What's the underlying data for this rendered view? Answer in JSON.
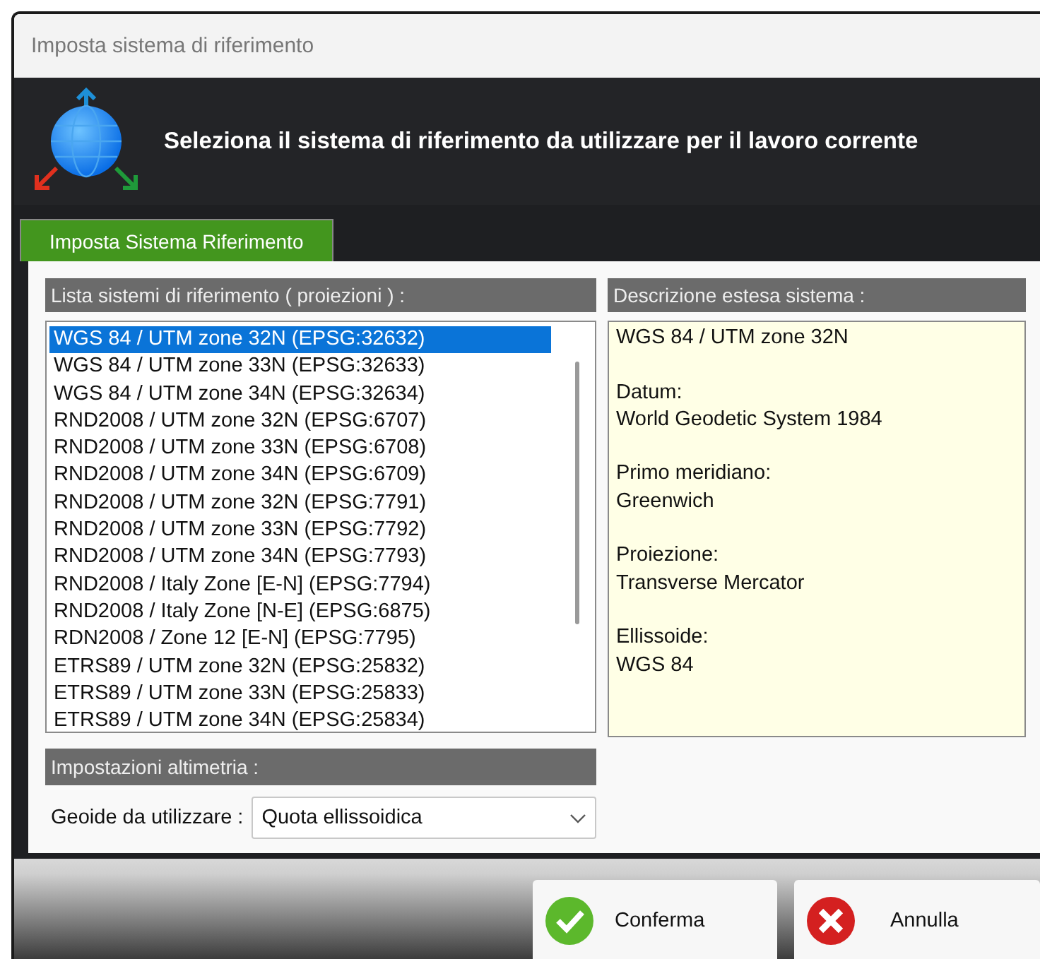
{
  "window": {
    "title": "Imposta sistema di riferimento"
  },
  "header": {
    "message": "Seleziona il sistema di riferimento da utilizzare per il lavoro corrente"
  },
  "tabs": [
    {
      "label": "Imposta Sistema Riferimento",
      "selected": true
    }
  ],
  "projection_list": {
    "heading": "Lista sistemi di riferimento ( proiezioni ) :",
    "items": [
      {
        "label": "WGS 84 / UTM zone 32N (EPSG:32632)",
        "selected": true
      },
      {
        "label": "WGS 84 / UTM zone 33N (EPSG:32633)",
        "selected": false
      },
      {
        "label": "WGS 84 / UTM zone 34N (EPSG:32634)",
        "selected": false
      },
      {
        "label": "RND2008 / UTM zone 32N (EPSG:6707)",
        "selected": false
      },
      {
        "label": "RND2008 / UTM zone 33N (EPSG:6708)",
        "selected": false
      },
      {
        "label": "RND2008 / UTM zone 34N (EPSG:6709)",
        "selected": false
      },
      {
        "label": "RND2008 / UTM zone 32N (EPSG:7791)",
        "selected": false
      },
      {
        "label": "RND2008 / UTM zone 33N (EPSG:7792)",
        "selected": false
      },
      {
        "label": "RND2008 / UTM zone 34N (EPSG:7793)",
        "selected": false
      },
      {
        "label": "RND2008 / Italy Zone [E-N] (EPSG:7794)",
        "selected": false
      },
      {
        "label": "RND2008 / Italy Zone [N-E] (EPSG:6875)",
        "selected": false
      },
      {
        "label": "RDN2008 / Zone 12 [E-N] (EPSG:7795)",
        "selected": false
      },
      {
        "label": "ETRS89 / UTM zone 32N (EPSG:25832)",
        "selected": false
      },
      {
        "label": "ETRS89 / UTM zone 33N (EPSG:25833)",
        "selected": false
      },
      {
        "label": "ETRS89 / UTM zone 34N (EPSG:25834)",
        "selected": false
      }
    ]
  },
  "description": {
    "heading": "Descrizione estesa sistema :",
    "title": "WGS 84 / UTM zone 32N",
    "fields": [
      {
        "label": "Datum:",
        "value": "World Geodetic System 1984"
      },
      {
        "label": "Primo meridiano:",
        "value": "Greenwich"
      },
      {
        "label": "Proiezione:",
        "value": "Transverse Mercator"
      },
      {
        "label": "Ellissoide:",
        "value": "WGS 84"
      }
    ]
  },
  "altimetry": {
    "heading": "Impostazioni altimetria :",
    "geoid_label": "Geoide da utilizzare :",
    "geoid_value": "Quota ellissoidica"
  },
  "buttons": [
    {
      "label": "Conferma",
      "kind": "confirm"
    },
    {
      "label": "Annulla",
      "kind": "cancel"
    }
  ]
}
